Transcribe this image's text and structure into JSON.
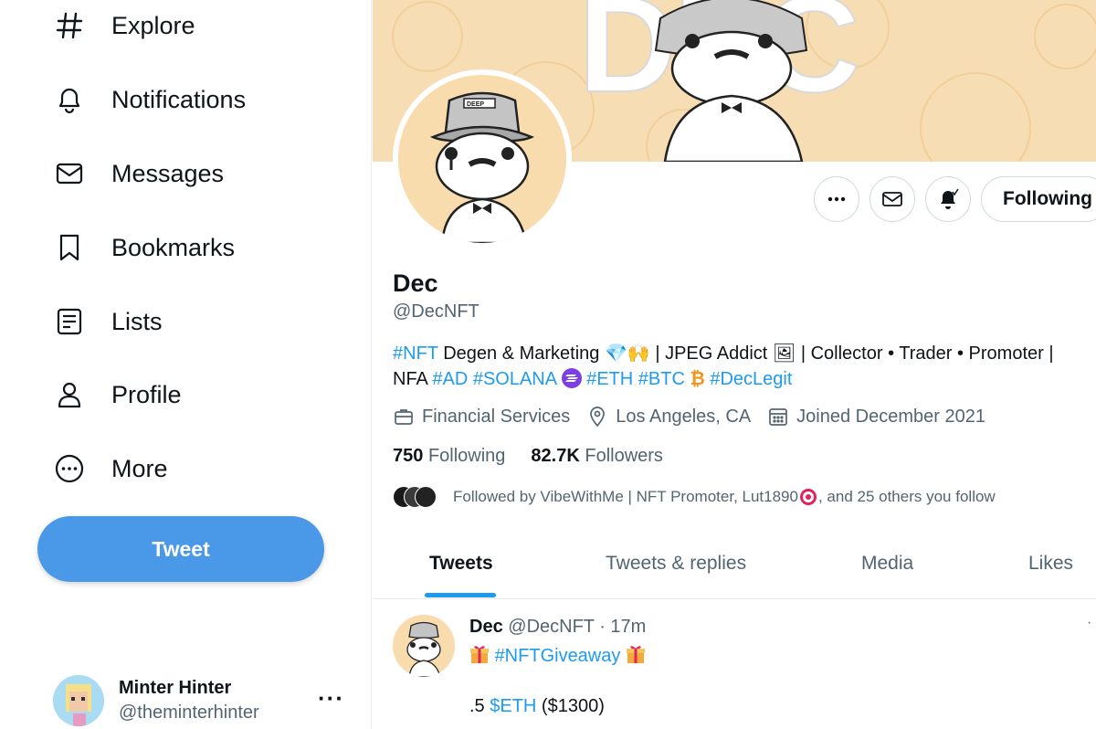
{
  "sidebar": {
    "items": [
      {
        "label": "Explore",
        "icon": "hashtag-icon"
      },
      {
        "label": "Notifications",
        "icon": "bell-icon"
      },
      {
        "label": "Messages",
        "icon": "envelope-icon"
      },
      {
        "label": "Bookmarks",
        "icon": "bookmark-icon"
      },
      {
        "label": "Lists",
        "icon": "list-icon"
      },
      {
        "label": "Profile",
        "icon": "person-icon"
      },
      {
        "label": "More",
        "icon": "more-circle-icon"
      }
    ],
    "tweet_label": "Tweet",
    "account": {
      "name": "Minter Hinter",
      "handle": "@theminterhinter",
      "more": "···"
    }
  },
  "profile": {
    "banner_text": "DEC",
    "avatar_hat_text": "DEEP",
    "name": "Dec",
    "handle": "@DecNFT",
    "following_button": "Following",
    "bio": {
      "line1": {
        "tag1": "#NFT",
        "t1": " Degen & Marketing 💎🙌 | JPEG Addict 🖼 | Collector • Trader • Promoter |"
      },
      "line2": {
        "t0": "NFA ",
        "tag_ad": "#AD",
        "tag_solana": "#SOLANA",
        "tag_eth": "#ETH",
        "tag_btc": "#BTC",
        "btc_symbol": "₿",
        "tag_declegit": "#DecLegit"
      }
    },
    "meta": {
      "category": "Financial Services",
      "location": "Los Angeles, CA",
      "joined": "Joined December 2021"
    },
    "stats": {
      "following_count": "750",
      "following_label": "Following",
      "followers_count": "82.7K",
      "followers_label": "Followers"
    },
    "followed_by": {
      "prefix": "Followed by VibeWithMe | NFT Promoter, Lut1890",
      "suffix": ", and 25 others you follow"
    }
  },
  "tabs": [
    "Tweets",
    "Tweets & replies",
    "Media",
    "Likes"
  ],
  "tweet": {
    "name": "Dec",
    "meta": "@DecNFT · 17m",
    "tag": "#NFTGiveaway",
    "line2_prefix": ".5 ",
    "line2_tag": "$ETH",
    "line2_suffix": " ($1300)"
  },
  "colors": {
    "accent": "#1d9bf0",
    "tweet_button": "#4a99e9",
    "banner": "#f7ddb3"
  }
}
